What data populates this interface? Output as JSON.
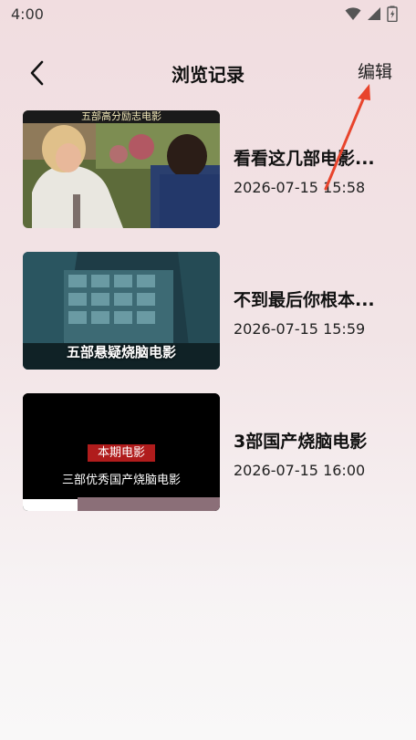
{
  "status_bar": {
    "time": "4:00"
  },
  "header": {
    "title": "浏览记录",
    "edit_label": "编辑"
  },
  "history": [
    {
      "title": "看看这几部电影...",
      "time": "2026-07-15 15:58",
      "thumb_caption": "五部高分励志电影"
    },
    {
      "title": "不到最后你根本...",
      "time": "2026-07-15 15:59",
      "thumb_caption": "五部悬疑烧脑电影"
    },
    {
      "title": "3部国产烧脑电影",
      "time": "2026-07-15 16:00",
      "thumb_tag": "本期电影",
      "thumb_caption": "三部优秀国产烧脑电影"
    }
  ],
  "colors": {
    "annotation_arrow": "#e8442c",
    "tag_bg": "#b01c1c"
  },
  "icons": {
    "back": "chevron-left-icon",
    "wifi": "wifi-icon",
    "signal": "signal-icon",
    "battery": "battery-icon"
  }
}
